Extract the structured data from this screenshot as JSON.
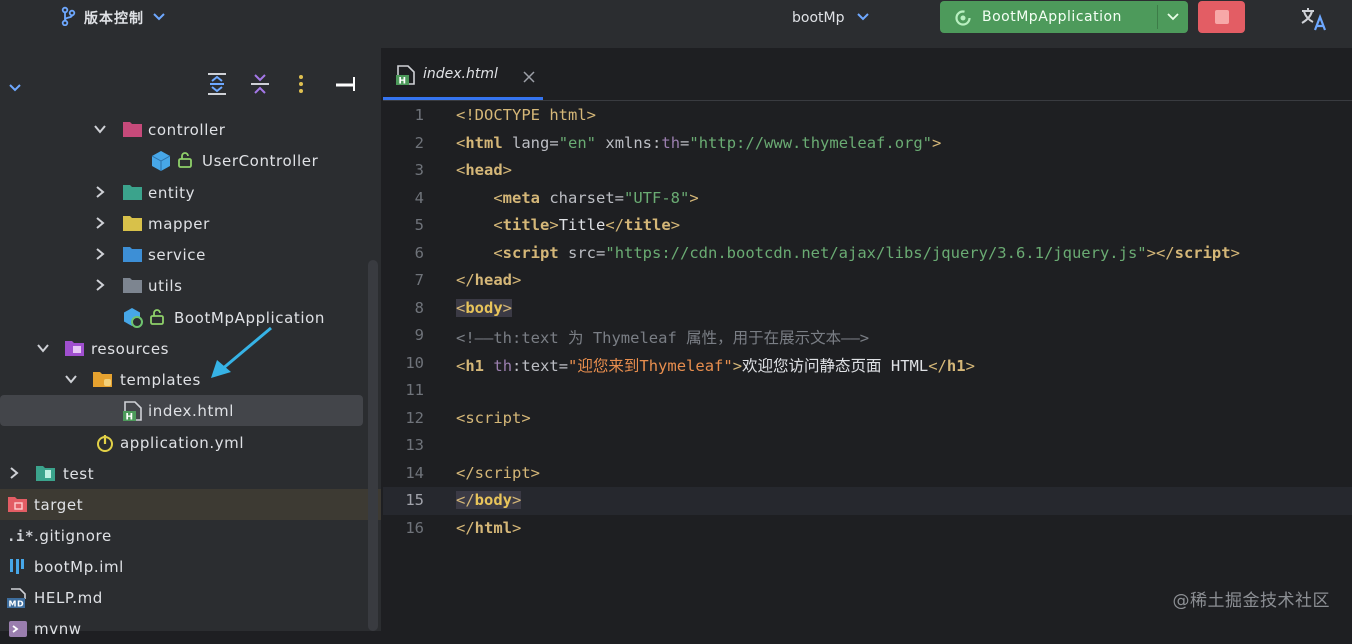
{
  "topbar": {
    "vcs_label": "版本控制",
    "project_name": "bootMp",
    "run_config": "BootMpApplication"
  },
  "tree": {
    "items": [
      {
        "label": "controller",
        "icon": "package-folder-icon"
      },
      {
        "label": "UserController",
        "icon": "spring-bean-icon"
      },
      {
        "label": "entity",
        "icon": "package-folder-icon"
      },
      {
        "label": "mapper",
        "icon": "package-folder-icon"
      },
      {
        "label": "service",
        "icon": "package-folder-icon"
      },
      {
        "label": "utils",
        "icon": "package-folder-icon"
      },
      {
        "label": "BootMpApplication",
        "icon": "spring-boot-class-icon"
      },
      {
        "label": "resources",
        "icon": "resources-folder-icon"
      },
      {
        "label": "templates",
        "icon": "folder-icon"
      },
      {
        "label": "index.html",
        "icon": "html-file-icon"
      },
      {
        "label": "application.yml",
        "icon": "yaml-file-icon"
      },
      {
        "label": "test",
        "icon": "test-folder-icon"
      },
      {
        "label": "target",
        "icon": "excluded-folder-icon"
      },
      {
        "label": ".gitignore",
        "icon": "gitignore-file-icon"
      },
      {
        "label": "bootMp.iml",
        "icon": "iml-file-icon"
      },
      {
        "label": "HELP.md",
        "icon": "markdown-file-icon"
      },
      {
        "label": "mvnw",
        "icon": "shell-file-icon"
      }
    ]
  },
  "editor": {
    "tab_label": "index.html",
    "current_line": 15,
    "lines": [
      {
        "n": "1"
      },
      {
        "n": "2"
      },
      {
        "n": "3"
      },
      {
        "n": "4"
      },
      {
        "n": "5"
      },
      {
        "n": "6"
      },
      {
        "n": "7"
      },
      {
        "n": "8"
      },
      {
        "n": "9"
      },
      {
        "n": "10"
      },
      {
        "n": "11"
      },
      {
        "n": "12"
      },
      {
        "n": "13"
      },
      {
        "n": "14"
      },
      {
        "n": "15"
      },
      {
        "n": "16"
      }
    ],
    "code": {
      "l1_doctype": "<!DOCTYPE ",
      "l1_html": "html",
      "l1_close": ">",
      "l2_tag": "html",
      "l2_lang_attr": "lang",
      "l2_lang_val": "\"en\"",
      "l2_xmlns": "xmlns",
      "l2_th": "th",
      "l2_xmlns_val": "\"http://www.thymeleaf.org\"",
      "l3_head": "head",
      "l4_meta": "meta",
      "l4_charset": "charset",
      "l4_charset_val": "\"UTF-8\"",
      "l5_title": "title",
      "l5_text": "Title",
      "l6_script": "script",
      "l6_src": "src",
      "l6_src_val": "\"https://cdn.bootcdn.net/ajax/libs/jquery/3.6.1/jquery.js\"",
      "l7_head": "head",
      "l8_body": "body",
      "l9_comment": "<!——th:text 为 Thymeleaf 属性，用于在展示文本——>",
      "l10_h1": "h1",
      "l10_th": "th",
      "l10_text_attr": "text",
      "l10_text_val": "\"迎您来到Thymeleaf\"",
      "l10_content": "欢迎您访问静态页面 HTML",
      "l12_script": "script",
      "l14_script": "script",
      "l15_body": "body",
      "l16_html": "html"
    }
  },
  "watermark": "@稀土掘金技术社区",
  "colors": {
    "run_green": "#4d9a5b",
    "stop_red": "#e35d64",
    "selection": "#43454a",
    "tab_underline": "#3574f0"
  }
}
